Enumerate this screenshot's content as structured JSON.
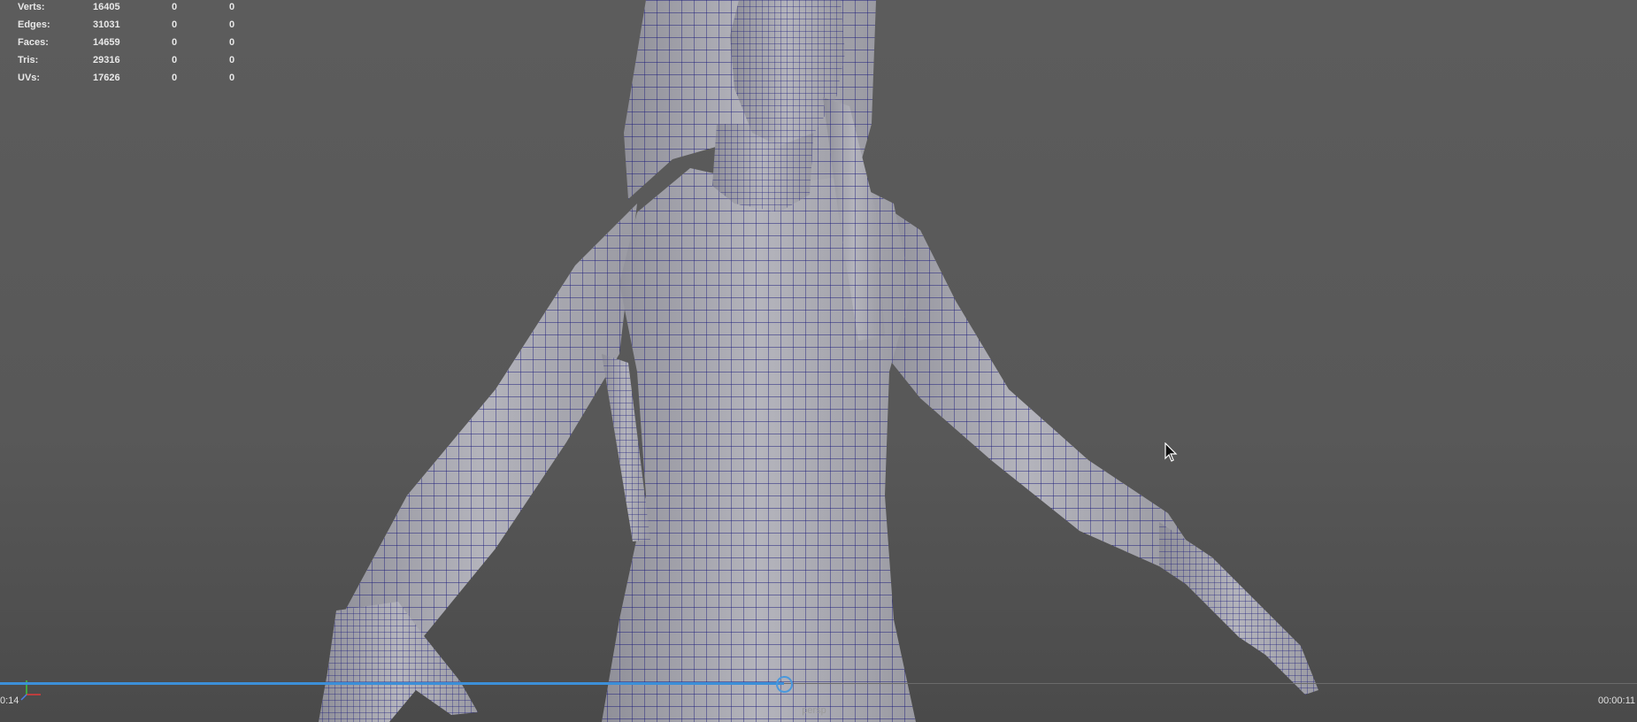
{
  "stats": [
    {
      "label": "Verts:",
      "total": "16405",
      "selected": "0",
      "components": "0"
    },
    {
      "label": "Edges:",
      "total": "31031",
      "selected": "0",
      "components": "0"
    },
    {
      "label": "Faces:",
      "total": "14659",
      "selected": "0",
      "components": "0"
    },
    {
      "label": "Tris:",
      "total": "29316",
      "selected": "0",
      "components": "0"
    },
    {
      "label": "UVs:",
      "total": "17626",
      "selected": "0",
      "components": "0"
    }
  ],
  "timeline": {
    "current_time": "0:14",
    "end_time": "00:00:11",
    "progress": 0.479
  },
  "camera": "persp",
  "colors": {
    "wire": "#1a1a78",
    "progress": "#3c8fd8"
  }
}
